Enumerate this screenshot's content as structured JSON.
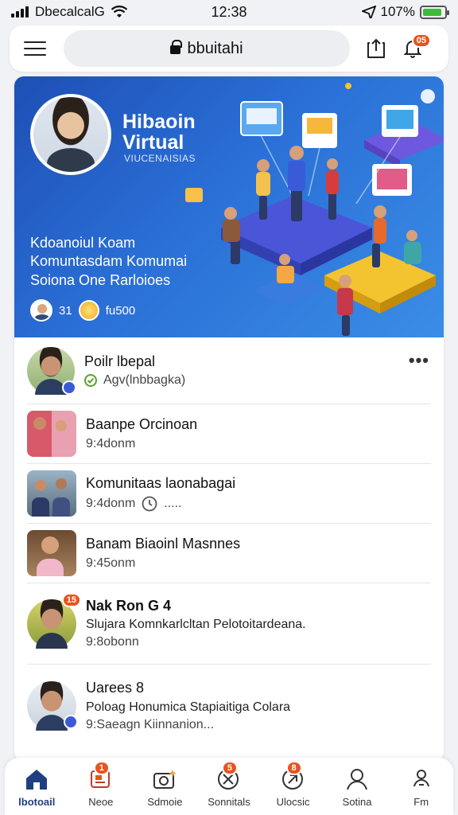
{
  "status": {
    "carrier": "DbecalcalG",
    "time": "12:38",
    "battery": "107%",
    "battery_level": 0.9
  },
  "topbar": {
    "search_text": "bbuitahi",
    "notif_badge": "05"
  },
  "hero": {
    "title_line1": "Hibaoin",
    "title_line2": "Virtual",
    "subtitle": "VIUCENAISIAS",
    "desc_line1": "Kdoanoiul Koam",
    "desc_line2": "Komuntasdam Komumai",
    "desc_line3": "Soiona One Rarloioes",
    "meta_count": "31",
    "meta_text": "fu500"
  },
  "feed": [
    {
      "name": "Poilr lbepal",
      "sub": "Agv(lnbbagka)",
      "more": "•••"
    },
    {
      "name": "Baanpe Orcinoan",
      "sub": "9:4donm"
    },
    {
      "name": "Komunitaas laonabagai",
      "sub": "9:4donm",
      "sub_extra": "....."
    },
    {
      "name": "Banam Biaoinl Masnnes",
      "sub": "9:45onm"
    },
    {
      "name": "Nak Ron G 4",
      "sub": "Slujara Komnkarlcltan Pelotoitardeana.",
      "sub2": "9:8obonn",
      "badge": "15"
    },
    {
      "name": "Uarees 8",
      "sub": "Poloag Honumica Stapiaitiga Colara",
      "sub2": "9:Saeagn Kiinnanion..."
    }
  ],
  "nav": [
    {
      "label": "lbotoail",
      "icon": "home-icon",
      "active": true
    },
    {
      "label": "Neoe",
      "icon": "news-icon",
      "badge": "1"
    },
    {
      "label": "Sdmoie",
      "icon": "camera-icon"
    },
    {
      "label": "Sonnitals",
      "icon": "chat-icon",
      "badge": "5"
    },
    {
      "label": "Ulocsic",
      "icon": "music-icon",
      "badge": "8"
    },
    {
      "label": "Sotina",
      "icon": "profile-icon"
    },
    {
      "label": "Fm",
      "icon": "people-icon"
    }
  ],
  "colors": {
    "accent": "#1f3f80",
    "badge": "#e8531e",
    "hero_bg": "#2a6fd6"
  }
}
